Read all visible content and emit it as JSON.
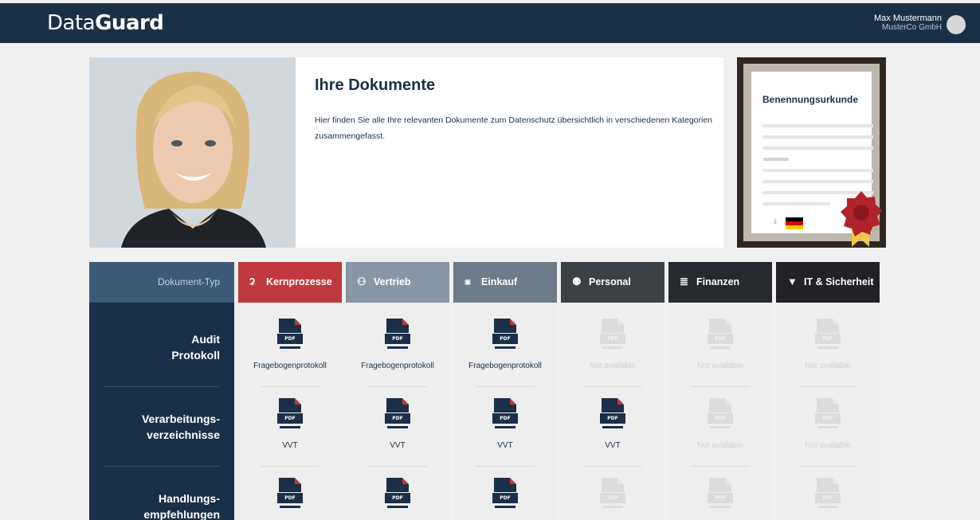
{
  "header": {
    "logo_light": "Data",
    "logo_bold": "Guard",
    "user_name": "Max Mustermann",
    "company": "MusterCo GmbH"
  },
  "intro": {
    "title": "Ihre Dokumente",
    "text": "Hier finden Sie alle Ihre relevanten Dokumente zum Datenschutz übersichtlich in verschiedenen Kategorien zusammengefasst."
  },
  "certificate": {
    "title": "Benennungsurkunde",
    "download_icon": "download-icon",
    "language": "de"
  },
  "table": {
    "type_label": "Dokument-Typ",
    "rows": [
      "Audit Protokoll",
      "Verarbeitungs-verzeichnisse",
      "Handlungs-empfehlungen"
    ],
    "categories": [
      {
        "label": "Kernprozesse",
        "icon": "stethoscope-icon",
        "color": "#c0393f"
      },
      {
        "label": "Vertrieb",
        "icon": "people-icon",
        "color": "#8896a6"
      },
      {
        "label": "Einkauf",
        "icon": "cart-icon",
        "color": "#6e7b88"
      },
      {
        "label": "Personal",
        "icon": "group-icon",
        "color": "#3c4146"
      },
      {
        "label": "Finanzen",
        "icon": "coins-icon",
        "color": "#262a2e"
      },
      {
        "label": "IT & Sicherheit",
        "icon": "shield-icon",
        "color": "#202225"
      }
    ],
    "cells": [
      [
        "Fragebogenprotokoll",
        "Fragebogenprotokoll",
        "Fragebogenprotokoll",
        "Not available",
        "Not available",
        "Not available"
      ],
      [
        "VVT",
        "VVT",
        "VVT",
        "VVT",
        "Not available",
        "Not available"
      ],
      [
        "",
        "",
        "",
        "",
        "",
        ""
      ]
    ],
    "available": [
      [
        true,
        true,
        true,
        false,
        false,
        false
      ],
      [
        true,
        true,
        true,
        true,
        false,
        false
      ],
      [
        true,
        true,
        true,
        false,
        false,
        false
      ]
    ],
    "pdf_label": "PDF"
  }
}
